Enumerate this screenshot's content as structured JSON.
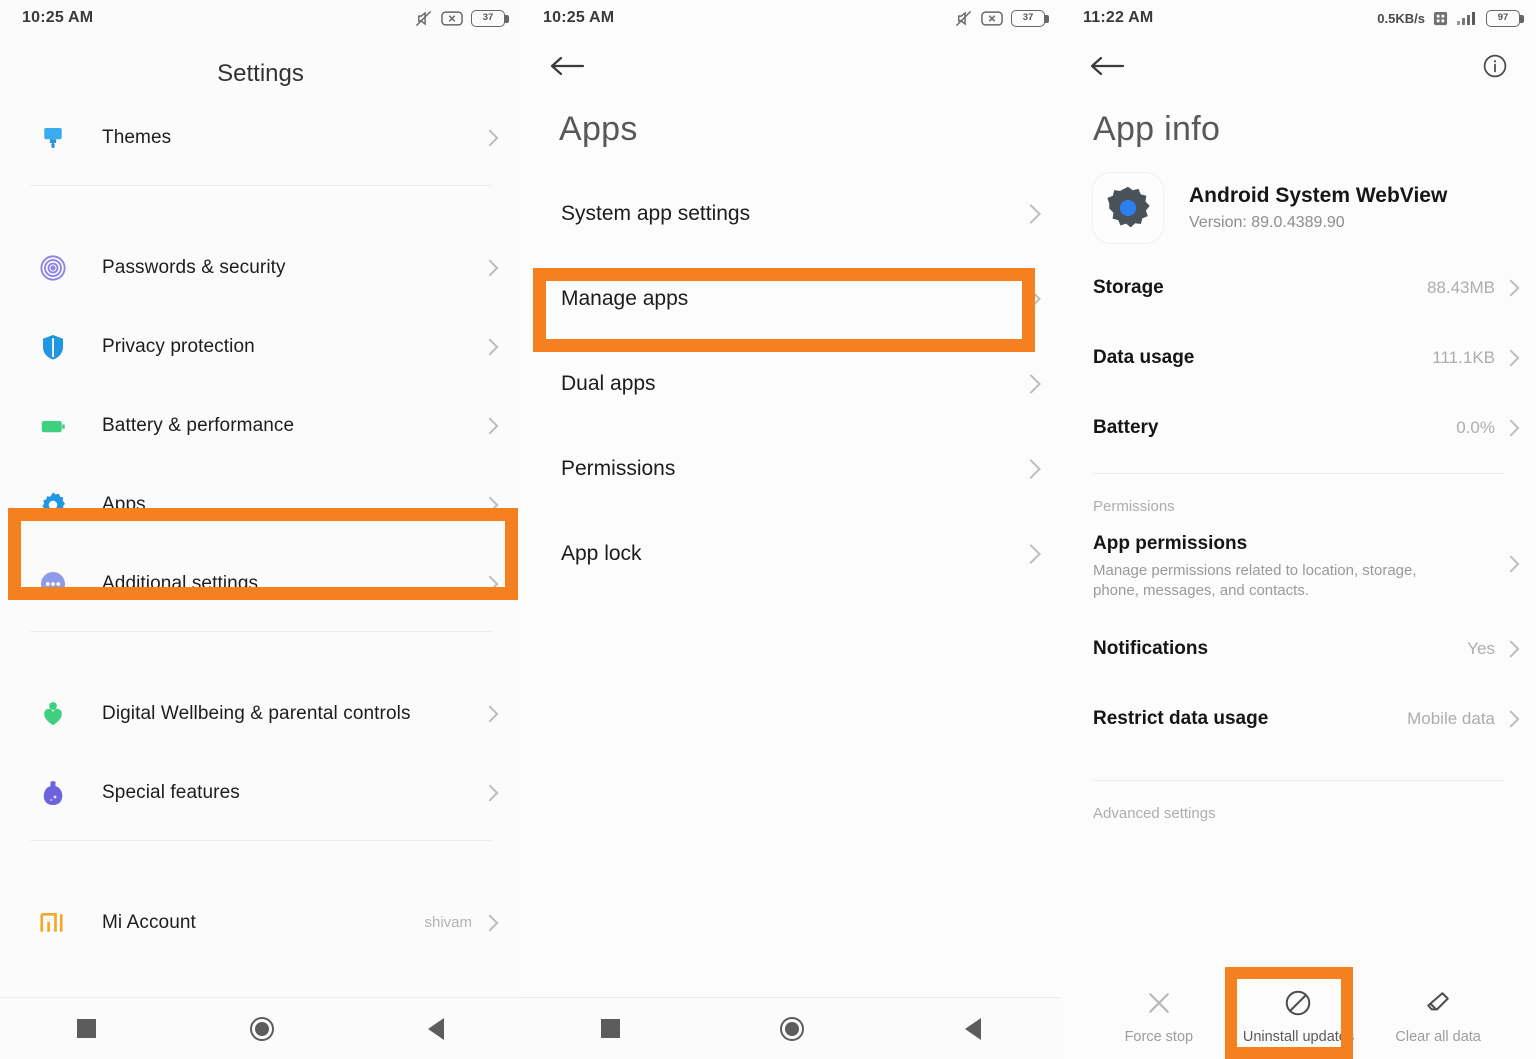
{
  "panel1": {
    "statusbar": {
      "time": "10:25 AM",
      "battery_level": "37",
      "icons": [
        "mute-icon",
        "x-box-icon",
        "battery-icon"
      ]
    },
    "header_title": "Settings",
    "items": [
      {
        "label": "Themes",
        "icon": "paintbrush-icon",
        "color": "#3cabf0",
        "value": ""
      },
      {
        "label": "Passwords & security",
        "icon": "fingerprint-icon",
        "color": "#8f84e8",
        "value": ""
      },
      {
        "label": "Privacy protection",
        "icon": "shield-icon",
        "color": "#2196e3",
        "value": ""
      },
      {
        "label": "Battery & performance",
        "icon": "battery-icon",
        "color": "#3ed07e",
        "value": ""
      },
      {
        "label": "Apps",
        "icon": "gear-icon",
        "color": "#2196e3",
        "value": ""
      },
      {
        "label": "Additional settings",
        "icon": "more-dots-icon",
        "color": "#8f9be8",
        "value": ""
      },
      {
        "label": "Digital Wellbeing & parental controls",
        "icon": "wellbeing-heart-icon",
        "color": "#3ed07e",
        "value": ""
      },
      {
        "label": "Special features",
        "icon": "flask-icon",
        "color": "#6f63dd",
        "value": ""
      },
      {
        "label": "Mi Account",
        "icon": "mi-logo-icon",
        "color": "#f5a623",
        "value": "shivam"
      }
    ],
    "highlight": "Apps"
  },
  "panel2": {
    "statusbar": {
      "time": "10:25 AM",
      "battery_level": "37",
      "icons": [
        "mute-icon",
        "x-box-icon",
        "battery-icon"
      ]
    },
    "back_icon": "back-arrow-icon",
    "title": "Apps",
    "items": [
      {
        "label": "System app settings"
      },
      {
        "label": "Manage apps"
      },
      {
        "label": "Dual apps"
      },
      {
        "label": "Permissions"
      },
      {
        "label": "App lock"
      }
    ],
    "highlight": "Manage apps"
  },
  "panel3": {
    "statusbar": {
      "time": "11:22 AM",
      "net_speed": "0.5KB/s",
      "battery_level": "97",
      "icons": [
        "square-icon",
        "signal-icon",
        "battery-icon"
      ]
    },
    "back_icon": "back-arrow-icon",
    "info_icon": "info-icon",
    "title": "App info",
    "app": {
      "name": "Android System WebView",
      "version": "Version: 89.0.4389.90",
      "icon": "gear-app-icon"
    },
    "stats": [
      {
        "label": "Storage",
        "value": "88.43MB"
      },
      {
        "label": "Data usage",
        "value": "111.1KB"
      },
      {
        "label": "Battery",
        "value": "0.0%"
      }
    ],
    "permissions_section_label": "Permissions",
    "permissions": [
      {
        "label": "App permissions",
        "sub": "Manage permissions related to location, storage, phone, messages, and contacts.",
        "value": ""
      },
      {
        "label": "Notifications",
        "sub": "",
        "value": "Yes"
      },
      {
        "label": "Restrict data usage",
        "sub": "",
        "value": "Mobile data"
      }
    ],
    "advanced_section_label": "Advanced settings",
    "actions": [
      {
        "label": "Force stop",
        "icon": "close-x-icon",
        "highlighted": false
      },
      {
        "label": "Uninstall updates",
        "icon": "no-entry-icon",
        "highlighted": true
      },
      {
        "label": "Clear all data",
        "icon": "eraser-icon",
        "highlighted": false
      }
    ],
    "highlight": "Uninstall updates"
  },
  "navbar": {
    "recents": "recents-square-icon",
    "home": "home-circle-icon",
    "back": "back-triangle-icon"
  },
  "colors": {
    "highlight": "#f4801f",
    "accent_blue": "#2196e3"
  }
}
